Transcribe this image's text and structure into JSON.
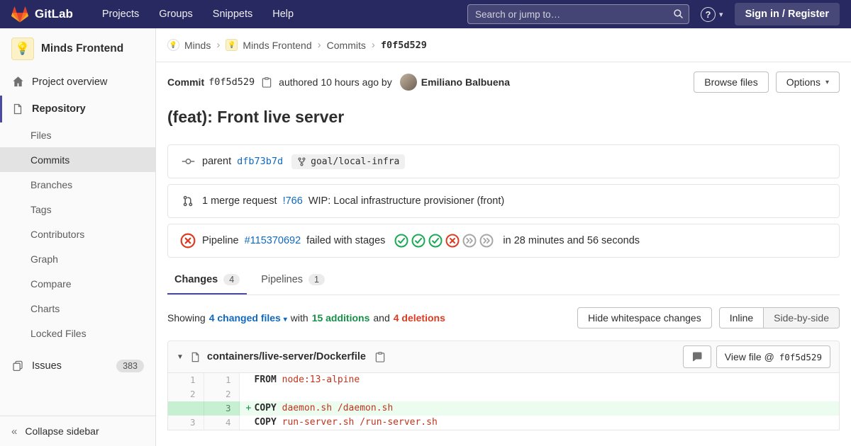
{
  "navbar": {
    "brand": "GitLab",
    "menu": [
      "Projects",
      "Groups",
      "Snippets",
      "Help"
    ],
    "search_placeholder": "Search or jump to…",
    "help_icon": "?",
    "sign_in_label": "Sign in / Register"
  },
  "sidebar": {
    "project_avatar": "💡",
    "project_name": "Minds Frontend",
    "overview_label": "Project overview",
    "repository_label": "Repository",
    "repository_items": [
      "Files",
      "Commits",
      "Branches",
      "Tags",
      "Contributors",
      "Graph",
      "Compare",
      "Charts",
      "Locked Files"
    ],
    "active_item": "Commits",
    "issues_label": "Issues",
    "issues_count": "383",
    "collapse_label": "Collapse sidebar"
  },
  "breadcrumb": {
    "group": "Minds",
    "group_avatar": "💡",
    "project": "Minds Frontend",
    "project_avatar": "💡",
    "section": "Commits",
    "commit_sha": "f0f5d529"
  },
  "commit_header": {
    "commit_label": "Commit",
    "sha": "f0f5d529",
    "authored_text": "authored 10 hours ago by",
    "author": "Emiliano Balbuena",
    "browse_files_label": "Browse files",
    "options_label": "Options"
  },
  "commit": {
    "title": "(feat): Front live server",
    "parent_label": "parent",
    "parent_sha": "dfb73b7d",
    "branch_label": "goal/local-infra",
    "mr_count_text": "1 merge request",
    "mr_ref": "!766",
    "mr_title": "WIP: Local infrastructure provisioner (front)",
    "pipeline_label": "Pipeline",
    "pipeline_id": "#115370692",
    "pipeline_status_text": "failed with stages",
    "pipeline_stages": [
      "success",
      "success",
      "success",
      "failed",
      "skipped",
      "skipped"
    ],
    "pipeline_duration": "in 28 minutes and 56 seconds"
  },
  "tabs": {
    "changes_label": "Changes",
    "changes_count": "4",
    "pipelines_label": "Pipelines",
    "pipelines_count": "1"
  },
  "diff_controls": {
    "showing_label": "Showing",
    "changed_files": "4 changed files",
    "with_label": "with",
    "additions": "15 additions",
    "and_label": "and",
    "deletions": "4 deletions",
    "hide_whitespace_label": "Hide whitespace changes",
    "inline_label": "Inline",
    "side_by_side_label": "Side-by-side"
  },
  "diff_file": {
    "path": "containers/live-server/Dockerfile",
    "view_file_label": "View file @",
    "view_file_sha": "f0f5d529",
    "lines": [
      {
        "old": "1",
        "new": "1",
        "type": "context",
        "sign": "",
        "tokens": [
          [
            "k",
            "FROM"
          ],
          [
            "p",
            " "
          ],
          [
            "s",
            "node:13-alpine"
          ]
        ]
      },
      {
        "old": "2",
        "new": "2",
        "type": "context",
        "sign": "",
        "tokens": []
      },
      {
        "old": "",
        "new": "3",
        "type": "added",
        "sign": "+",
        "tokens": [
          [
            "k",
            "COPY"
          ],
          [
            "p",
            " "
          ],
          [
            "s",
            "daemon.sh /daemon.sh"
          ]
        ]
      },
      {
        "old": "3",
        "new": "4",
        "type": "context",
        "sign": "",
        "tokens": [
          [
            "k",
            "COPY"
          ],
          [
            "p",
            " "
          ],
          [
            "s",
            "run-server.sh /run-server.sh"
          ]
        ]
      }
    ]
  },
  "colors": {
    "navbar_bg": "#292961",
    "link_blue": "#1068bf",
    "success_green": "#1aaa55",
    "failed_red": "#db3b21",
    "addition_text": "#168f48",
    "deletion_text": "#db3b21"
  }
}
